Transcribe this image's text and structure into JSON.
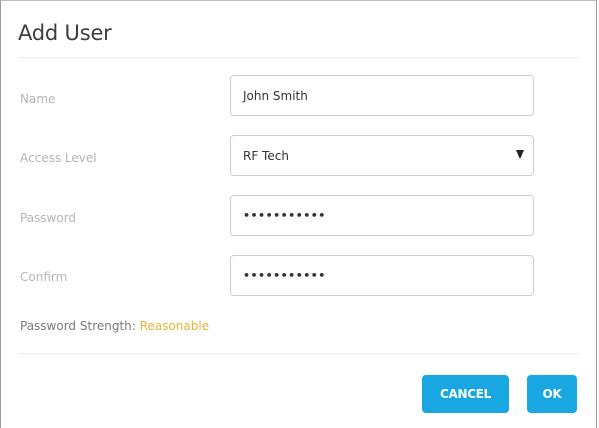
{
  "dialog": {
    "title": "Add User",
    "fields": {
      "name": {
        "label": "Name",
        "value": "John Smith"
      },
      "access_level": {
        "label": "Access Level",
        "value": "RF Tech"
      },
      "password": {
        "label": "Password",
        "value": "•••••••••••"
      },
      "confirm": {
        "label": "Confirm",
        "value": "•••••••••••"
      }
    },
    "strength": {
      "label": "Password Strength:",
      "value": "Reasonable"
    },
    "buttons": {
      "cancel": "CANCEL",
      "ok": "OK"
    }
  },
  "colors": {
    "accent": "#18a7e0",
    "strength_reasonable": "#e8b337"
  },
  "icons": {
    "select_arrow": "caret-down-icon"
  }
}
